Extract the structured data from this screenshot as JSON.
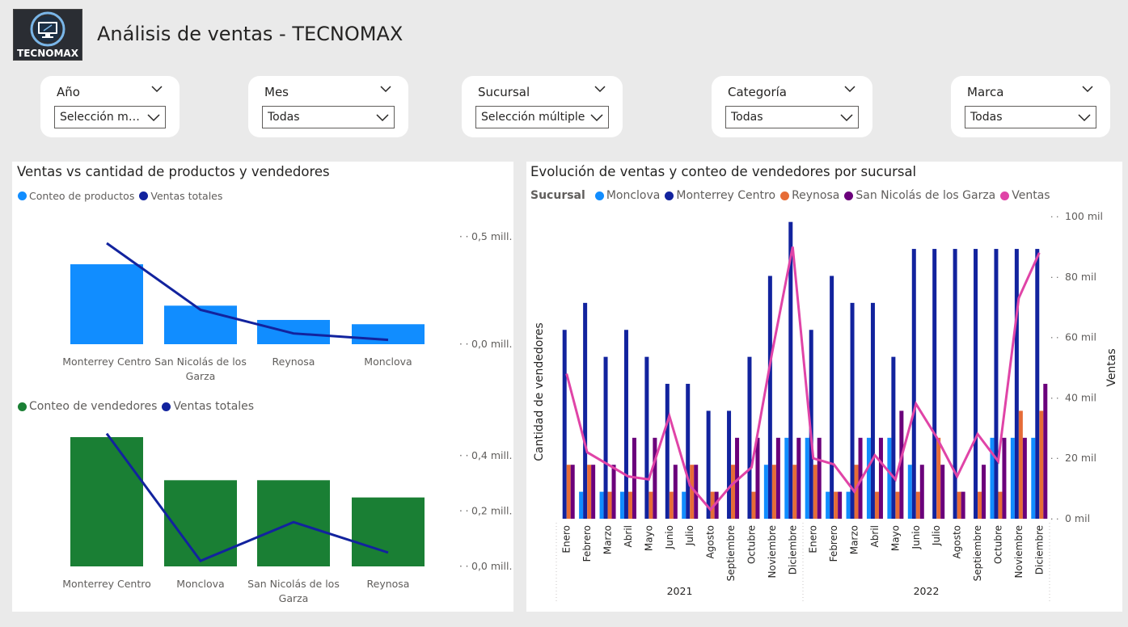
{
  "header": {
    "title": "Análisis de ventas - TECNOMAX",
    "logo_text": "TECNOMAX"
  },
  "filters": [
    {
      "label": "Año",
      "value": "Selección múlti..."
    },
    {
      "label": "Mes",
      "value": "Todas"
    },
    {
      "label": "Sucursal",
      "value": "Selección múltiple"
    },
    {
      "label": "Categoría",
      "value": "Todas"
    },
    {
      "label": "Marca",
      "value": "Todas"
    }
  ],
  "panel_left": {
    "title": "Ventas vs cantidad de productos y vendedores"
  },
  "colors": {
    "bar_blue": "#118dff",
    "line_navy": "#12239e",
    "bar_green": "#1a7f34",
    "orange": "#e66c37",
    "purple": "#6b007b",
    "pink": "#e044a7"
  },
  "chart_data": [
    {
      "type": "bar",
      "legend": [
        "Conteo de productos",
        "Ventas totales"
      ],
      "categories": [
        "Monterrey Centro",
        "San Nicolás de los Garza",
        "Reynosa",
        "Monclova"
      ],
      "series": [
        {
          "name": "Conteo de productos",
          "values": [
            56,
            27,
            17,
            14
          ]
        },
        {
          "name": "Ventas totales",
          "values": [
            0.47,
            0.16,
            0.05,
            0.02
          ]
        }
      ],
      "y2_ticks": [
        "0,5 mill.",
        "0,0 mill."
      ],
      "y2lim": [
        0,
        0.5
      ]
    },
    {
      "type": "bar",
      "legend": [
        "Conteo de vendedores",
        "Ventas totales"
      ],
      "categories": [
        "Monterrey Centro",
        "Monclova",
        "San Nicolás de los Garza",
        "Reynosa"
      ],
      "series": [
        {
          "name": "Conteo de vendedores",
          "values": [
            6,
            4,
            4,
            3.2
          ]
        },
        {
          "name": "Ventas totales",
          "values": [
            0.48,
            0.02,
            0.16,
            0.05
          ]
        }
      ],
      "y2_ticks": [
        "0,4 mill.",
        "0,2 mill.",
        "0,0 mill."
      ],
      "y2lim": [
        0,
        0.4
      ]
    },
    {
      "type": "bar",
      "title": "Evolución de ventas y conteo de vendedores por sucursal",
      "legend_title": "Sucursal",
      "legend": [
        "Monclova",
        "Monterrey Centro",
        "Reynosa",
        "San Nicolás de los Garza",
        "Ventas"
      ],
      "ylabel": "Cantidad de vendedores",
      "y2label": "Ventas",
      "y2_ticks": [
        "100 mil",
        "80 mil",
        "60 mil",
        "40 mil",
        "20 mil",
        "0 mil"
      ],
      "y2lim": [
        0,
        100
      ],
      "months": [
        "Enero",
        "Febrero",
        "Marzo",
        "Abril",
        "Mayo",
        "Junio",
        "Julio",
        "Agosto",
        "Septiembre",
        "Octubre",
        "Noviembre",
        "Diciembre",
        "Enero",
        "Febrero",
        "Marzo",
        "Abril",
        "Mayo",
        "Junio",
        "Julio",
        "Agosto",
        "Septiembre",
        "Octubre",
        "Noviembre",
        "Diciembre"
      ],
      "years": [
        "2021",
        "2022"
      ],
      "series": [
        {
          "name": "Monclova",
          "values": [
            0,
            1,
            1,
            1,
            0,
            0,
            1,
            0,
            0,
            0,
            2,
            3,
            3,
            1,
            1,
            3,
            3,
            2,
            0,
            0,
            0,
            3,
            3,
            3
          ]
        },
        {
          "name": "Monterrey Centro",
          "values": [
            7,
            8,
            6,
            7,
            6,
            5,
            5,
            4,
            4,
            6,
            9,
            11,
            7,
            9,
            8,
            8,
            6,
            10,
            10,
            10,
            10,
            10,
            10,
            10
          ]
        },
        {
          "name": "Reynosa",
          "values": [
            2,
            2,
            1,
            1,
            1,
            1,
            2,
            1,
            2,
            1,
            2,
            2,
            2,
            1,
            2,
            1,
            1,
            1,
            3,
            1,
            1,
            1,
            4,
            4
          ]
        },
        {
          "name": "San Nicolás de los Garza",
          "values": [
            2,
            2,
            2,
            3,
            3,
            2,
            2,
            1,
            3,
            3,
            3,
            3,
            3,
            1,
            3,
            3,
            4,
            2,
            2,
            1,
            2,
            3,
            3,
            5
          ]
        },
        {
          "name": "Ventas",
          "values": [
            48,
            22,
            18,
            14,
            13,
            34,
            11,
            3,
            11,
            17,
            55,
            90,
            20,
            18,
            9,
            21,
            13,
            38,
            27,
            14,
            28,
            19,
            73,
            88
          ]
        }
      ]
    }
  ]
}
